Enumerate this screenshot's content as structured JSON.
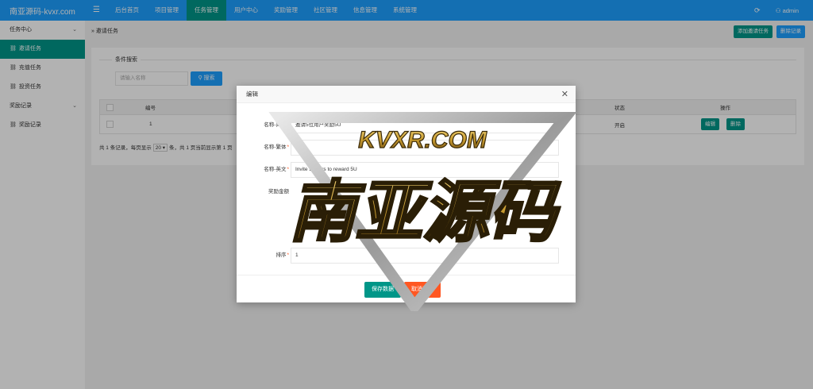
{
  "brand": "南亚源码-kvxr.com",
  "nav": {
    "menu_icon": "menu-icon",
    "items": [
      {
        "label": "后台首页",
        "active": false
      },
      {
        "label": "项目管理",
        "active": false
      },
      {
        "label": "任务管理",
        "active": true
      },
      {
        "label": "用户中心",
        "active": false
      },
      {
        "label": "奖励管理",
        "active": false
      },
      {
        "label": "社区管理",
        "active": false
      },
      {
        "label": "信息管理",
        "active": false
      },
      {
        "label": "系统管理",
        "active": false
      }
    ],
    "refresh_icon": "refresh-icon",
    "user": "admin"
  },
  "sidebar": {
    "group1": "任务中心",
    "active_item": "邀请任务",
    "items1": [
      "充值任务",
      "投资任务"
    ],
    "group2": "奖励记录",
    "items2": [
      "奖励记录"
    ]
  },
  "breadcrumb": "邀请任务",
  "header_buttons": {
    "add": "添加邀请任务",
    "delete": "删除记录"
  },
  "search": {
    "legend": "条件搜索",
    "placeholder": "请输入名称",
    "button": "搜索"
  },
  "table": {
    "headers": {
      "id": "编号",
      "status": "状态",
      "ops": "操作"
    },
    "rows": [
      {
        "id": "1",
        "status": "开启",
        "edit": "编辑",
        "delete": "删除"
      }
    ]
  },
  "pager": {
    "prefix": "共 1 条记录，每页显示",
    "per_page": "20",
    "suffix": "条，共 1 页当前显示第 1 页"
  },
  "modal": {
    "title": "编辑",
    "fields": [
      {
        "label": "名称-简体",
        "required": true,
        "value": "邀请5位用户奖励5U"
      },
      {
        "label": "名称-繁体",
        "required": true,
        "value": ""
      },
      {
        "label": "名称-英文",
        "required": true,
        "value": "Invite 5 users to reward 5U"
      },
      {
        "label": "奖励金额",
        "required": false,
        "value": ""
      },
      {
        "label": "",
        "required": false,
        "value": ""
      },
      {
        "label": "",
        "required": false,
        "value": ""
      },
      {
        "label": "排序",
        "required": true,
        "value": "1"
      }
    ],
    "save": "保存数据",
    "cancel": "取消编辑"
  },
  "watermark": {
    "top": "KVXR.COM",
    "main": "南亚源码"
  },
  "colors": {
    "primary": "#1e9fff",
    "teal": "#009688",
    "orange": "#ff5722"
  }
}
